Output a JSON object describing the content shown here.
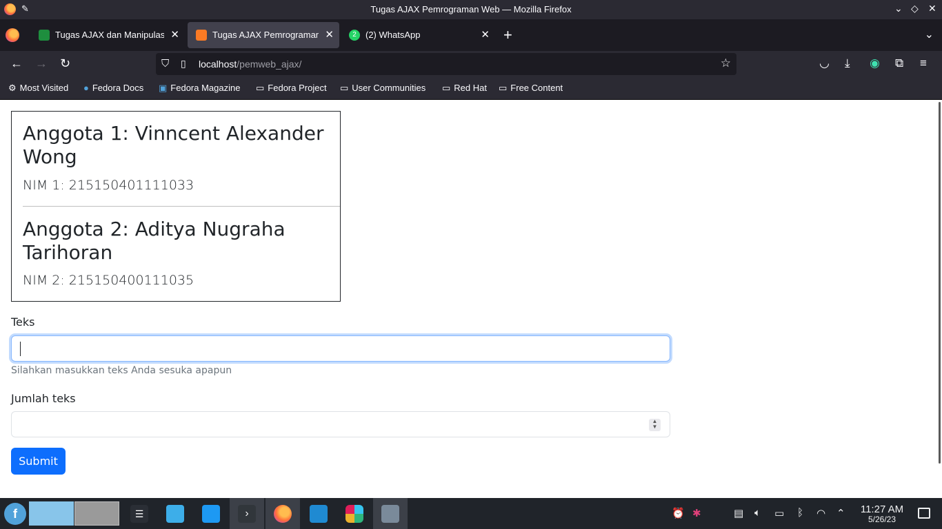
{
  "window": {
    "title": "Tugas AJAX Pemrograman Web — Mozilla Firefox"
  },
  "tabs": [
    {
      "label": "Tugas AJAX dan Manipulasi",
      "favicon": "google-classroom-icon",
      "active": false
    },
    {
      "label": "Tugas AJAX Pemrograman Web",
      "favicon": "xampp-icon",
      "active": true
    },
    {
      "label": "(2) WhatsApp",
      "favicon": "whatsapp-icon",
      "active": false
    }
  ],
  "urlbar": {
    "host": "localhost",
    "path": "/pemweb_ajax/"
  },
  "bookmarks": [
    {
      "label": "Most Visited",
      "icon": "gear-icon"
    },
    {
      "label": "Fedora Docs",
      "icon": "fedora-icon"
    },
    {
      "label": "Fedora Magazine",
      "icon": "fm-icon"
    },
    {
      "label": "Fedora Project",
      "icon": "folder-icon"
    },
    {
      "label": "User Communities",
      "icon": "folder-icon"
    },
    {
      "label": "Red Hat",
      "icon": "folder-icon"
    },
    {
      "label": "Free Content",
      "icon": "folder-icon"
    }
  ],
  "members": [
    {
      "name_line1": "Anggota 1: Vinncent Alexander",
      "name_line2": "Wong",
      "nim": "NIM 1: 215150401111033"
    },
    {
      "name_line1": "Anggota 2: Aditya Nugraha",
      "name_line2": "Tarihoran",
      "nim": "NIM 2: 215150400111035"
    }
  ],
  "form": {
    "text_label": "Teks",
    "text_value": "",
    "text_help": "Silahkan masukkan teks Anda sesuka apapun",
    "count_label": "Jumlah teks",
    "count_value": "",
    "submit_label": "Submit"
  },
  "taskbar": {
    "time": "11:27 AM",
    "date": "5/26/23"
  },
  "colors": {
    "primary": "#0d6efd",
    "focus_border": "#86b7fe",
    "chrome_dark": "#2b2a33",
    "taskbar": "#20242a"
  }
}
